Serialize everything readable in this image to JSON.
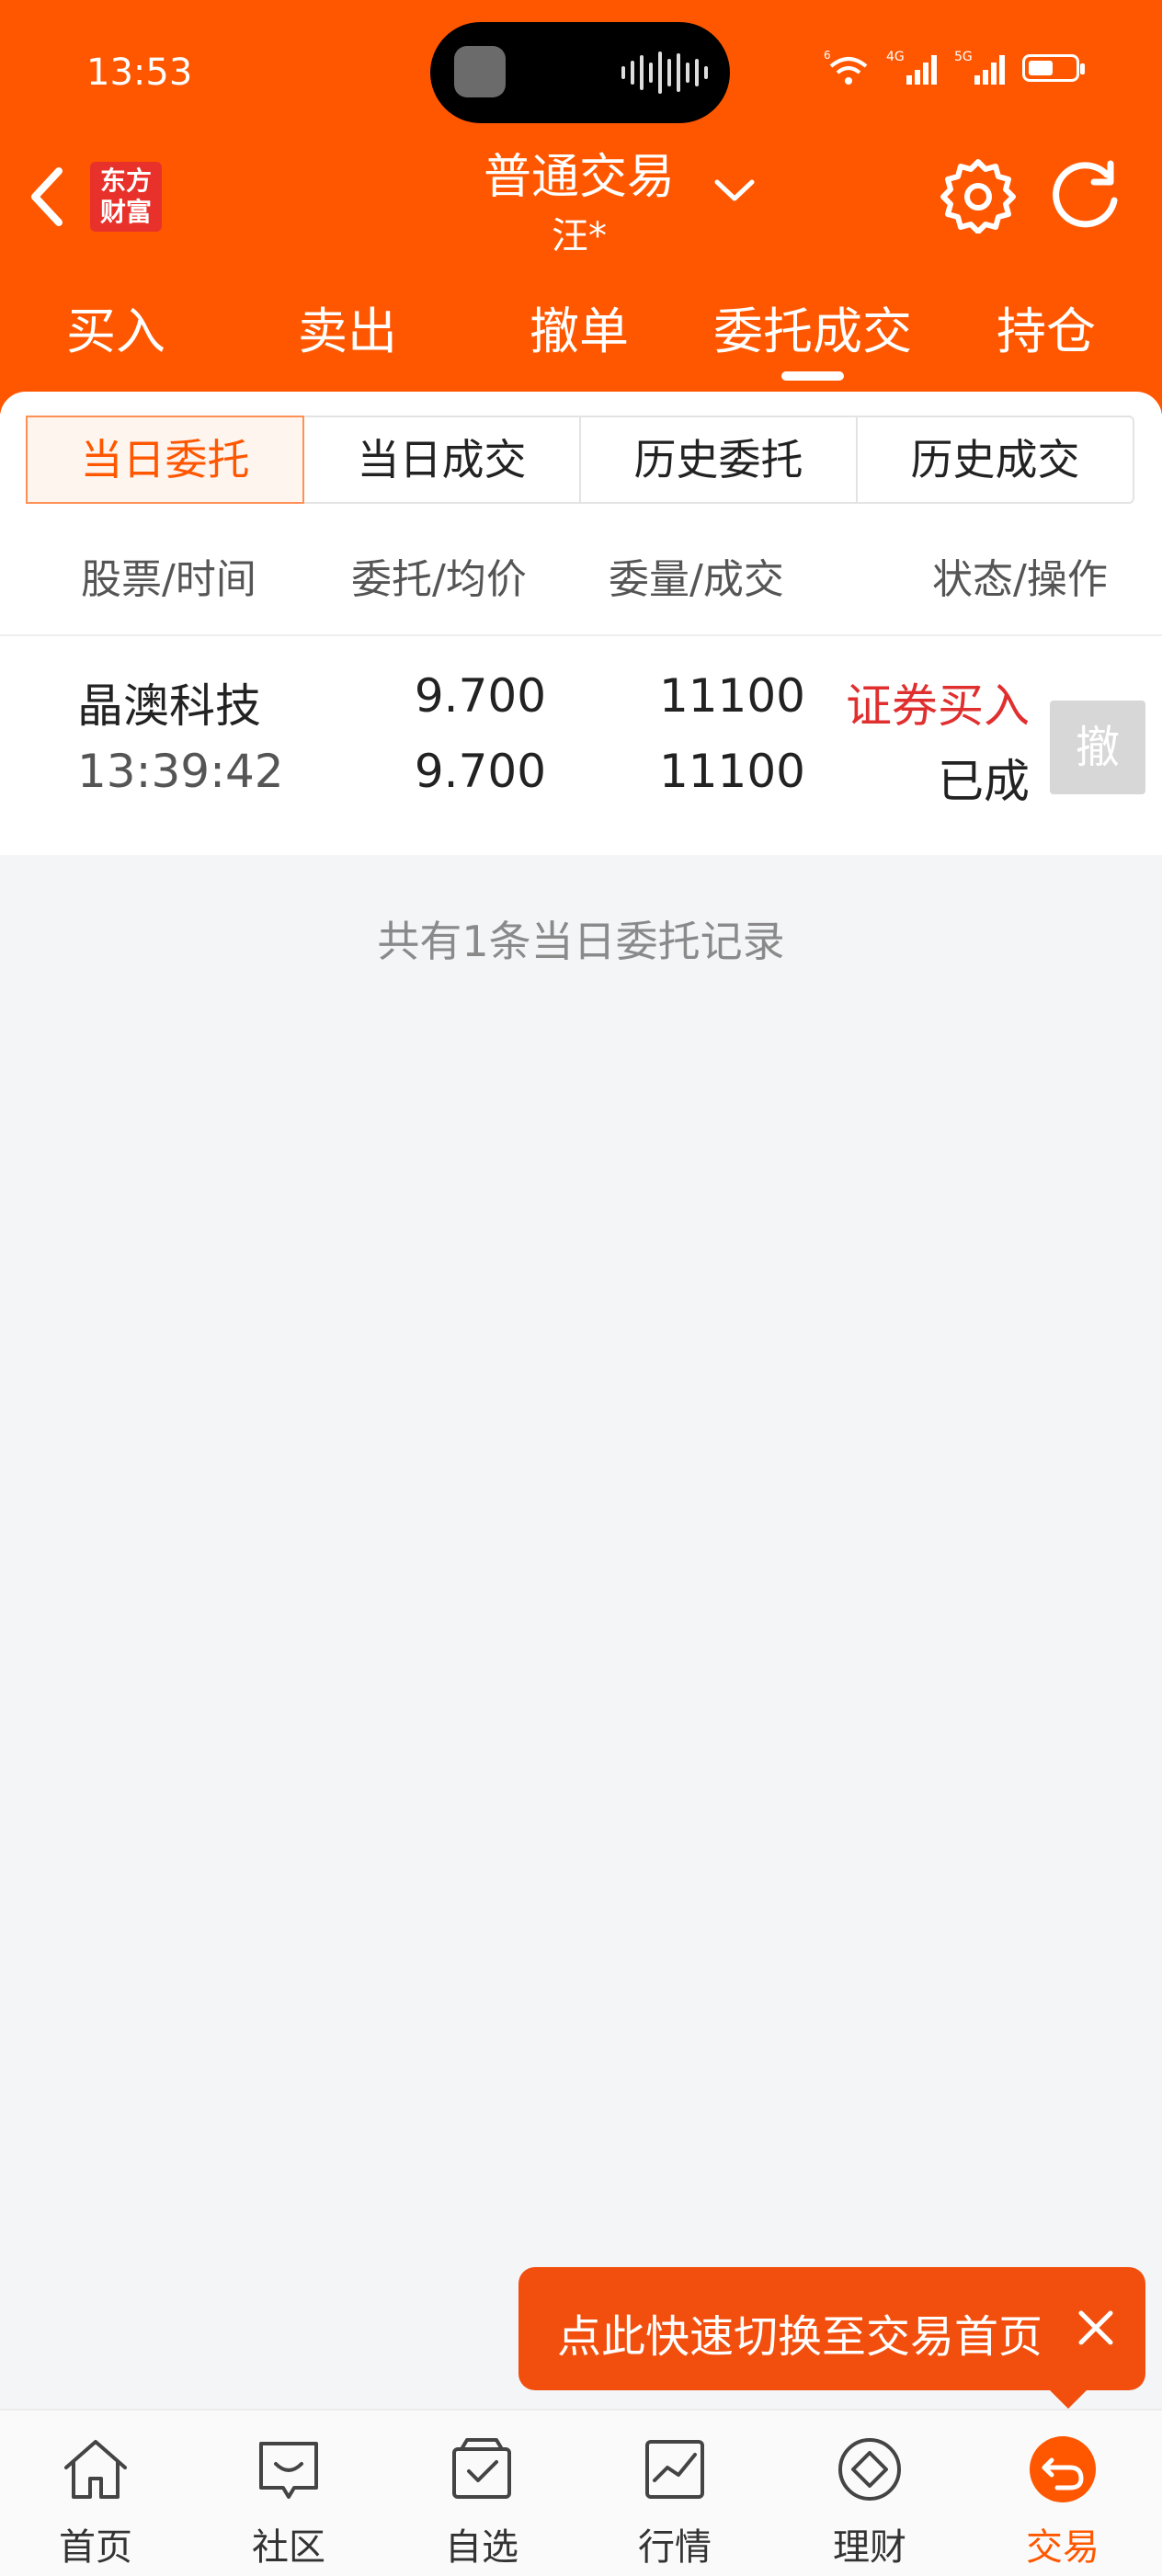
{
  "status_bar": {
    "time": "13:53",
    "network_1": "6",
    "network_2": "4G",
    "network_3": "5G"
  },
  "header": {
    "title": "普通交易",
    "subtitle": "汪*",
    "logo_line1": "东方",
    "logo_line2": "财富"
  },
  "main_tabs": [
    "买入",
    "卖出",
    "撤单",
    "委托成交",
    "持仓"
  ],
  "sub_tabs": [
    "当日委托",
    "当日成交",
    "历史委托",
    "历史成交"
  ],
  "columns": [
    "股票/时间",
    "委托/均价",
    "委量/成交",
    "状态/操作"
  ],
  "orders": [
    {
      "stock": "晶澳科技",
      "time": "13:39:42",
      "order_price": "9.700",
      "avg_price": "9.700",
      "order_qty": "11100",
      "filled_qty": "11100",
      "type": "证券买入",
      "status": "已成",
      "cancel_label": "撤"
    }
  ],
  "summary": "共有1条当日委托记录",
  "toast": {
    "text": "点此快速切换至交易首页"
  },
  "bottom_nav": [
    {
      "label": "首页",
      "icon": "home-icon"
    },
    {
      "label": "社区",
      "icon": "community-icon"
    },
    {
      "label": "自选",
      "icon": "watchlist-icon"
    },
    {
      "label": "行情",
      "icon": "market-icon"
    },
    {
      "label": "理财",
      "icon": "wealth-icon"
    },
    {
      "label": "交易",
      "icon": "trade-icon"
    }
  ],
  "colors": {
    "brand": "#ff5700",
    "buy_red": "#e02f2f"
  }
}
